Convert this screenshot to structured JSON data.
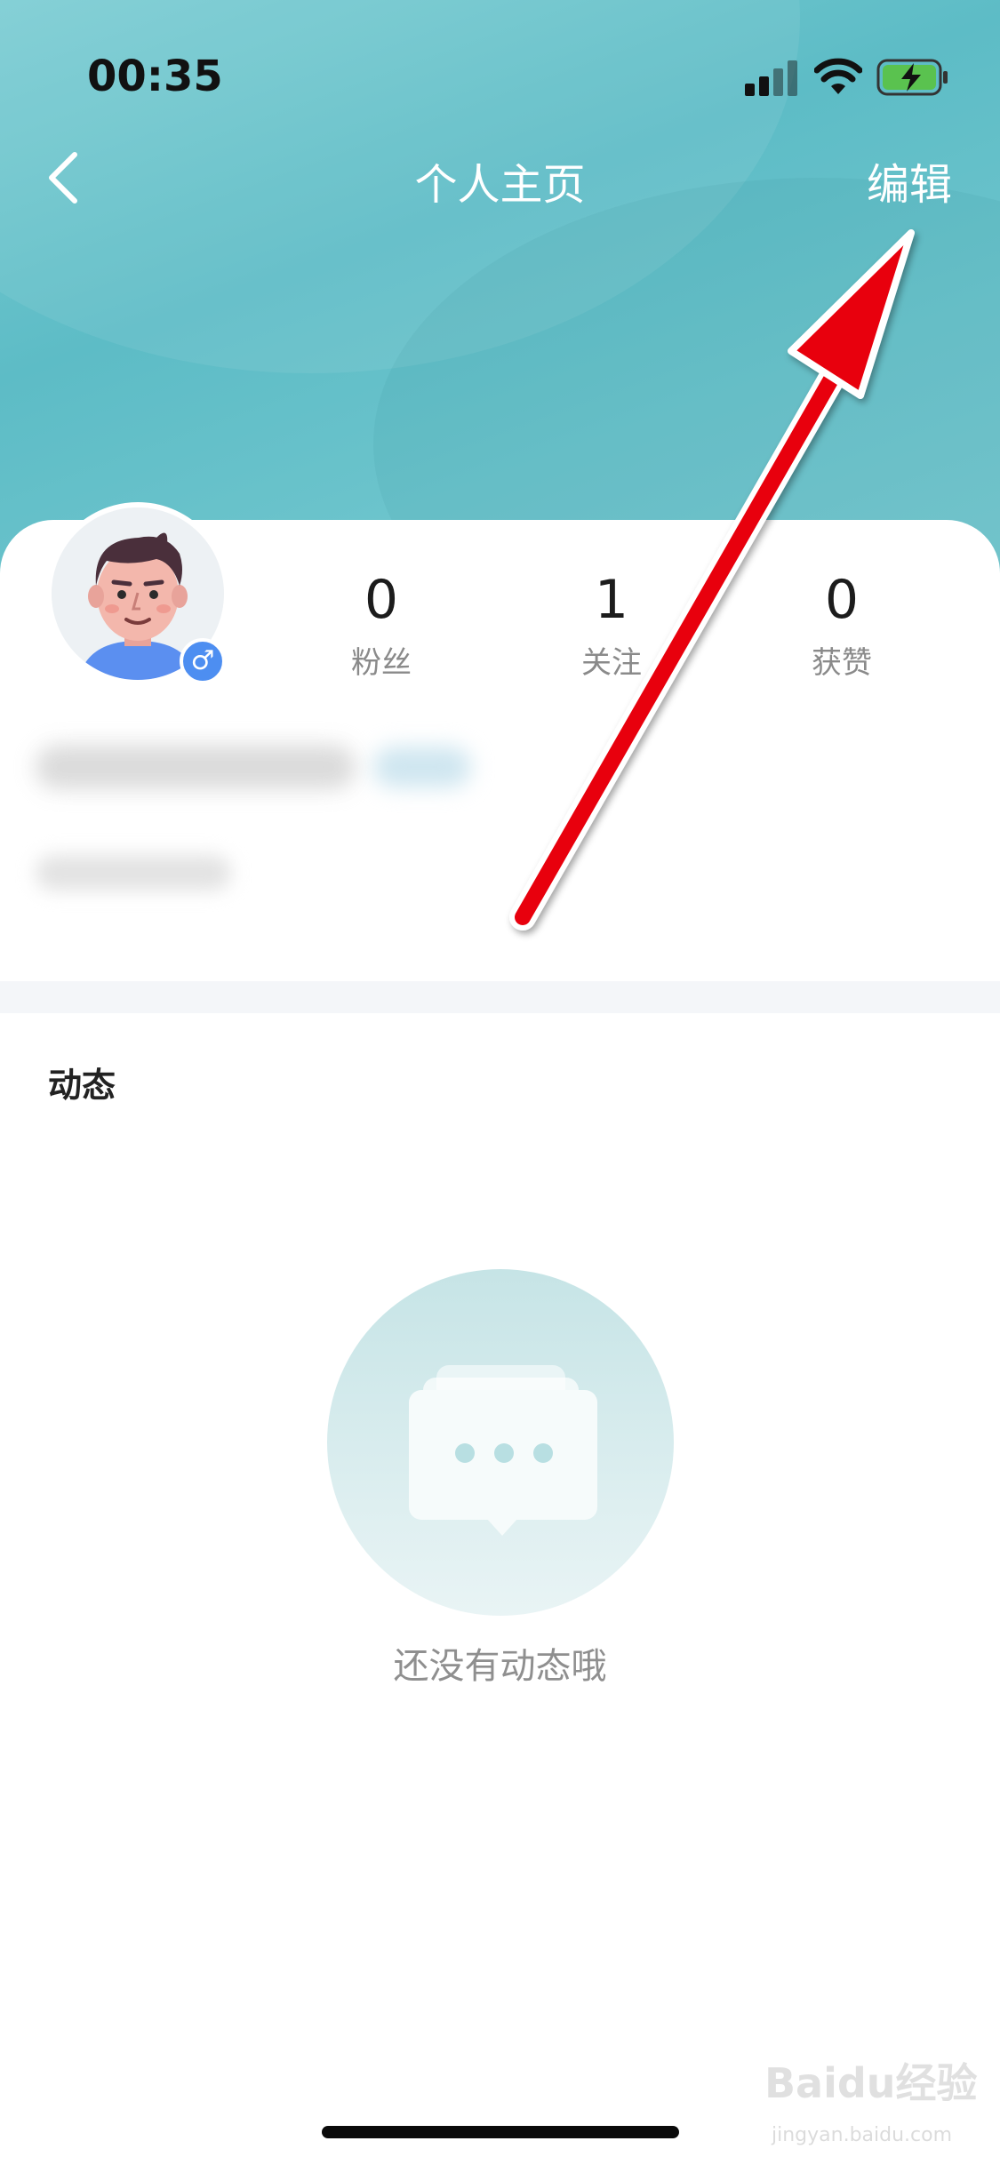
{
  "status_bar": {
    "time": "00:35"
  },
  "nav": {
    "title": "个人主页",
    "edit_label": "编辑"
  },
  "profile": {
    "gender_symbol": "♂",
    "stats": [
      {
        "value": "0",
        "label": "粉丝"
      },
      {
        "value": "1",
        "label": "关注"
      },
      {
        "value": "0",
        "label": "获赞"
      }
    ]
  },
  "feed": {
    "section_title": "动态",
    "empty_text": "还没有动态哦"
  },
  "watermark": {
    "brand": "Baidu经验",
    "url": "jingyan.baidu.com"
  },
  "colors": {
    "accent_header": "#5dbcc6",
    "gender_badge": "#4d8ef1",
    "annotation_arrow": "#e8000b"
  }
}
